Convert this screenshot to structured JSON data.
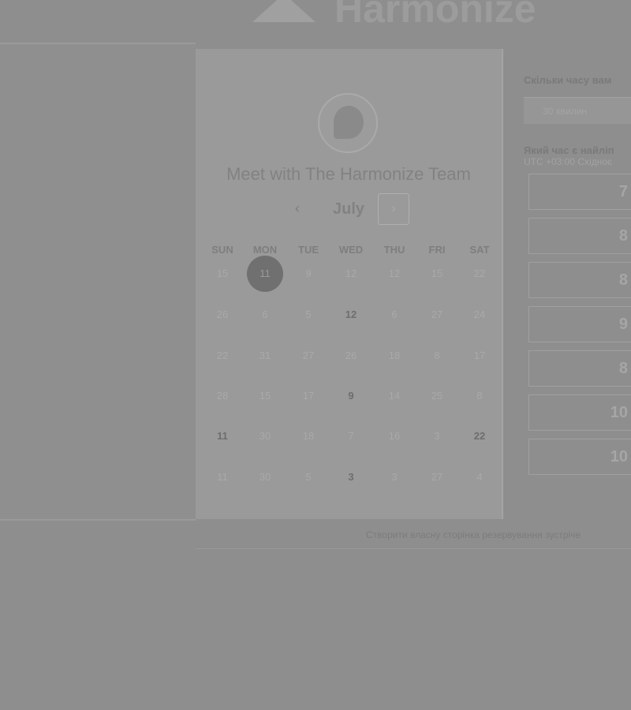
{
  "header": {
    "logo_text": "Harmonize"
  },
  "booking": {
    "title": "Meet with The Harmonize Team",
    "month": "July",
    "prev_icon": "chevron-left-icon",
    "next_icon": "chevron-right-icon"
  },
  "calendar": {
    "weekdays": [
      "SUN",
      "MON",
      "TUE",
      "WED",
      "THU",
      "FRI",
      "SAT"
    ],
    "weeks": [
      [
        {
          "d": "15"
        },
        {
          "d": "11",
          "selected": true
        },
        {
          "d": "9"
        },
        {
          "d": "12"
        },
        {
          "d": "12"
        },
        {
          "d": "15"
        },
        {
          "d": "22"
        }
      ],
      [
        {
          "d": "26"
        },
        {
          "d": "6"
        },
        {
          "d": "5"
        },
        {
          "d": "12",
          "available": true
        },
        {
          "d": "6"
        },
        {
          "d": "27"
        },
        {
          "d": "24"
        }
      ],
      [
        {
          "d": "22"
        },
        {
          "d": "31"
        },
        {
          "d": "27"
        },
        {
          "d": "26"
        },
        {
          "d": "18"
        },
        {
          "d": "8"
        },
        {
          "d": "17"
        }
      ],
      [
        {
          "d": "28"
        },
        {
          "d": "15"
        },
        {
          "d": "17"
        },
        {
          "d": "9",
          "available": true
        },
        {
          "d": "14"
        },
        {
          "d": "25"
        },
        {
          "d": "8"
        }
      ],
      [
        {
          "d": "11",
          "available": true
        },
        {
          "d": "30"
        },
        {
          "d": "18"
        },
        {
          "d": "7"
        },
        {
          "d": "16"
        },
        {
          "d": "3"
        },
        {
          "d": "22",
          "available": true
        }
      ],
      [
        {
          "d": "11"
        },
        {
          "d": "30"
        },
        {
          "d": "5"
        },
        {
          "d": "3",
          "available": true
        },
        {
          "d": "3"
        },
        {
          "d": "27"
        },
        {
          "d": "4"
        }
      ]
    ]
  },
  "right": {
    "duration_question": "Скільки часу вам",
    "duration_value": "30 хвилин",
    "time_question": "Який час є найліп",
    "timezone": "UTC +03:00 Східноє",
    "slots": [
      "7",
      "8",
      "8",
      "9",
      "8",
      "10",
      "10"
    ]
  },
  "footer": {
    "link": "Створити власну сторінка резервування зустріче"
  }
}
